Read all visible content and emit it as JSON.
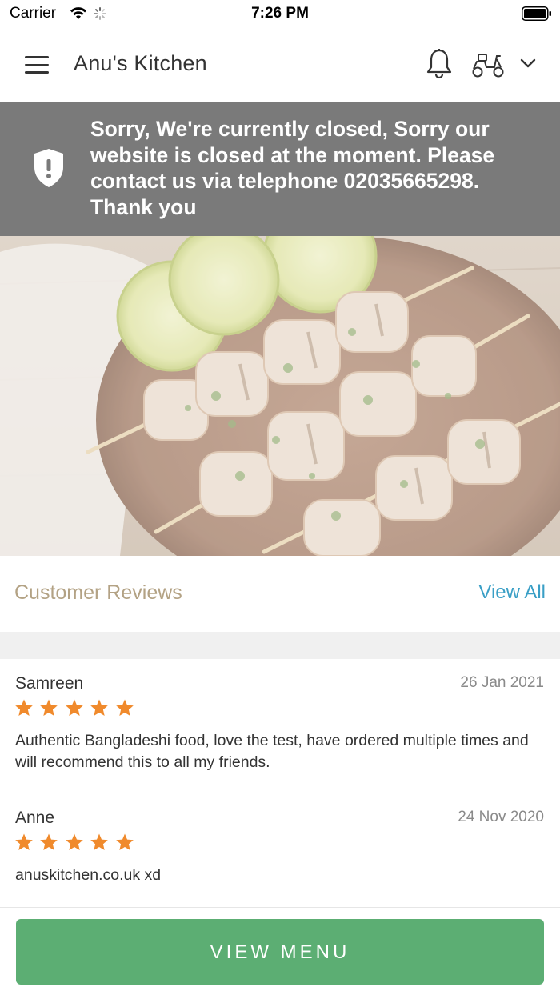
{
  "status_bar": {
    "carrier": "Carrier",
    "time": "7:26 PM"
  },
  "header": {
    "title": "Anu's Kitchen",
    "icons": [
      "menu-icon",
      "bell-icon",
      "scooter-icon",
      "chevron-down-icon"
    ]
  },
  "closed_banner": {
    "message": "Sorry, We're currently closed, Sorry our website is closed at the moment. Please contact us via telephone 02035665298. Thank you",
    "background_color": "#7a7a7a",
    "icon": "shield-alert-icon"
  },
  "hero": {
    "image_subject": "grilled chicken skewers with lime slices on a plate"
  },
  "reviews": {
    "title": "Customer Reviews",
    "view_all_label": "View All",
    "items": [
      {
        "name": "Samreen",
        "date": "26 Jan 2021",
        "rating": 5,
        "text": "Authentic Bangladeshi food, love the test, have ordered multiple times and will recommend this to all my friends."
      },
      {
        "name": "Anne",
        "date": "24 Nov 2020",
        "rating": 5,
        "text": "anuskitchen.co.uk xd"
      }
    ]
  },
  "footer": {
    "button_label": "VIEW MENU",
    "button_color": "#5cae73"
  },
  "colors": {
    "accent_blue": "#3a9fc6",
    "reviews_title": "#b3a284",
    "star": "#f08a2c"
  }
}
